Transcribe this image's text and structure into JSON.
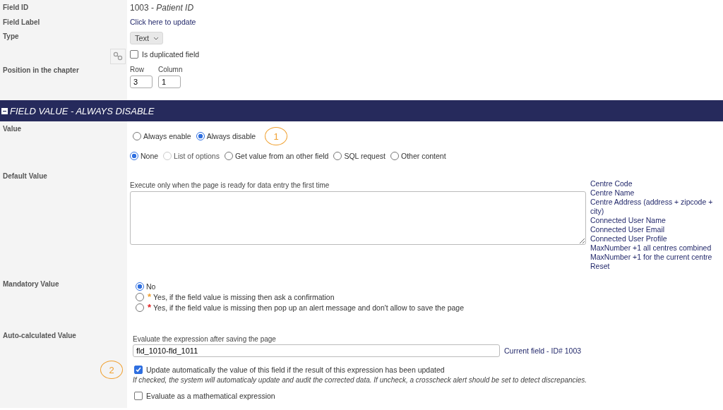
{
  "field_id": {
    "label": "Field ID",
    "value": "1003 - *Patient ID*"
  },
  "field_label": {
    "label": "Field Label",
    "link": "Click here to update"
  },
  "type": {
    "label": "Type",
    "value": "Text"
  },
  "duplicated": {
    "text": "Is duplicated field",
    "checked": false
  },
  "position": {
    "label": "Position in the chapter",
    "row": {
      "label": "Row",
      "value": "3"
    },
    "column": {
      "label": "Column",
      "value": "1"
    }
  },
  "section": {
    "title": "FIELD VALUE - ALWAYS DISABLE",
    "expanded": true
  },
  "value": {
    "label": "Value",
    "modes": [
      {
        "label": "Always enable",
        "selected": false
      },
      {
        "label": "Always disable",
        "selected": true
      }
    ],
    "sources": [
      {
        "label": "None",
        "selected": true,
        "disabled": false
      },
      {
        "label": "List of options",
        "selected": false,
        "disabled": true
      },
      {
        "label": "Get value from an other field",
        "selected": false,
        "disabled": false
      },
      {
        "label": "SQL request",
        "selected": false,
        "disabled": false
      },
      {
        "label": "Other content",
        "selected": false,
        "disabled": false
      }
    ]
  },
  "default_value": {
    "label": "Default Value",
    "hint": "Execute only when the page is ready for data entry the first time",
    "shortcuts": [
      "Centre Code",
      "Centre Name",
      "Centre Address (address + zipcode + city)",
      "Connected User Name",
      "Connected User Email",
      "Connected User Profile",
      "MaxNumber +1 all centres combined",
      "MaxNumber +1 for the current centre",
      "Reset"
    ]
  },
  "mandatory": {
    "label": "Mandatory Value",
    "options": [
      {
        "label": "No",
        "selected": true
      },
      {
        "label": "Yes, if the field value is missing then ask a confirmation",
        "selected": false,
        "marker": "*",
        "color": "#f0a030"
      },
      {
        "label": "Yes, if the field value is missing then pop up an alert message and don't allow to save the page",
        "selected": false,
        "marker": "*",
        "color": "#e02020"
      }
    ]
  },
  "auto_calculated": {
    "label": "Auto-calculated Value",
    "hint": "Evaluate the expression after saving the page",
    "expression": "fld_1010-fld_1011",
    "current": "Current field - ID# 1003",
    "auto_update": {
      "text": "Update automatically the value of this field if the result of this expression has been updated",
      "checked": true
    },
    "note": "If checked, the system will automaticaly update and audit the corrected data. If uncheck, a crosscheck alert should be set to detect discrepancies.",
    "mathematical": {
      "text": "Evaluate as a mathematical expression",
      "checked": false
    }
  },
  "annotations": [
    {
      "label": "1"
    },
    {
      "label": "2"
    }
  ]
}
